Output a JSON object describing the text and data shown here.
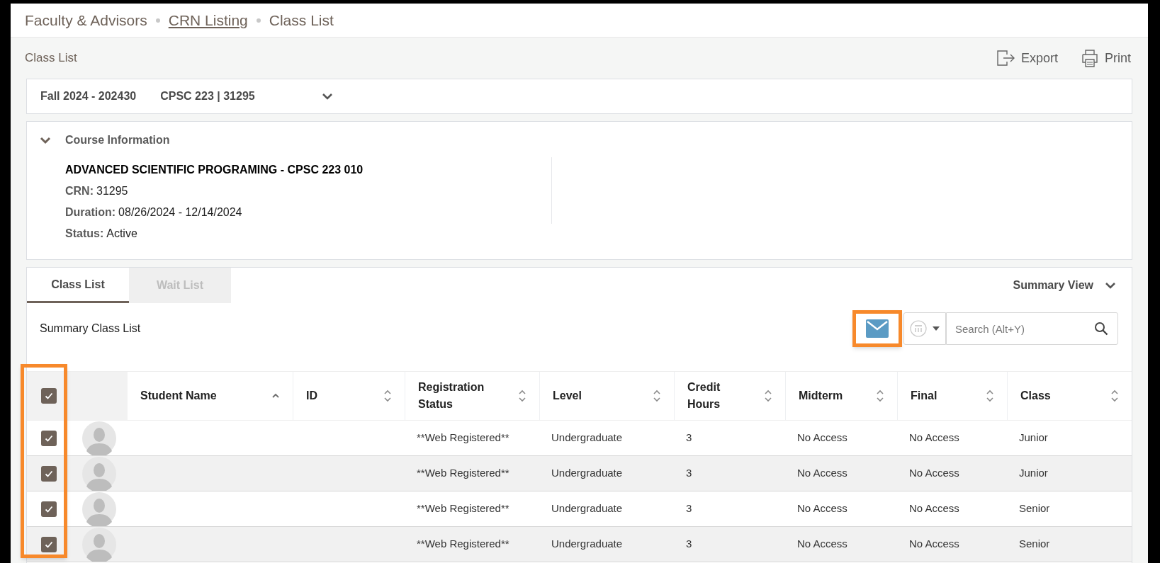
{
  "breadcrumbs": [
    {
      "label": "Faculty & Advisors",
      "link": false
    },
    {
      "label": "CRN Listing",
      "link": true
    },
    {
      "label": "Class List",
      "link": false
    }
  ],
  "page_title": "Class List",
  "actions": [
    {
      "kind": "export",
      "label": "Export"
    },
    {
      "kind": "print",
      "label": "Print"
    }
  ],
  "term": {
    "term": "Fall 2024 - 202430",
    "course": "CPSC 223 | 31295"
  },
  "course_info": {
    "heading": "Course Information",
    "expanded": true,
    "title": "ADVANCED SCIENTIFIC PROGRAMING - CPSC 223 010",
    "fields": [
      {
        "label": "CRN:",
        "value": "31295"
      },
      {
        "label": "Duration:",
        "value": "08/26/2024 - 12/14/2024"
      },
      {
        "label": "Status:",
        "value": "Active"
      }
    ]
  },
  "tabs": [
    {
      "label": "Class List",
      "selected": true
    },
    {
      "label": "Wait List",
      "selected": false
    }
  ],
  "view_menu": "Summary View",
  "list_title": "Summary Class List",
  "email_button": {
    "highlighted": true
  },
  "search": {
    "placeholder": "Search (Alt+Y)"
  },
  "table": {
    "select_all": {
      "checked": true
    },
    "select_column_highlighted": true,
    "columns": [
      {
        "label": "Student Name",
        "sorted": true
      },
      {
        "label": "ID",
        "sorted": false
      },
      {
        "label": "Registration Status",
        "sorted": false
      },
      {
        "label": "Level",
        "sorted": false
      },
      {
        "label": "Credit Hours",
        "sorted": false
      },
      {
        "label": "Midterm",
        "sorted": false
      },
      {
        "label": "Final",
        "sorted": false
      },
      {
        "label": "Class",
        "sorted": false
      }
    ],
    "rows": [
      {
        "checked": true,
        "registration_status": "**Web Registered**",
        "level": "Undergraduate",
        "credit_hours": "3",
        "midterm": "No Access",
        "final": "No Access",
        "class": "Junior"
      },
      {
        "checked": true,
        "registration_status": "**Web Registered**",
        "level": "Undergraduate",
        "credit_hours": "3",
        "midterm": "No Access",
        "final": "No Access",
        "class": "Junior"
      },
      {
        "checked": true,
        "registration_status": "**Web Registered**",
        "level": "Undergraduate",
        "credit_hours": "3",
        "midterm": "No Access",
        "final": "No Access",
        "class": "Senior"
      },
      {
        "checked": true,
        "registration_status": "**Web Registered**",
        "level": "Undergraduate",
        "credit_hours": "3",
        "midterm": "No Access",
        "final": "No Access",
        "class": "Senior"
      }
    ]
  }
}
